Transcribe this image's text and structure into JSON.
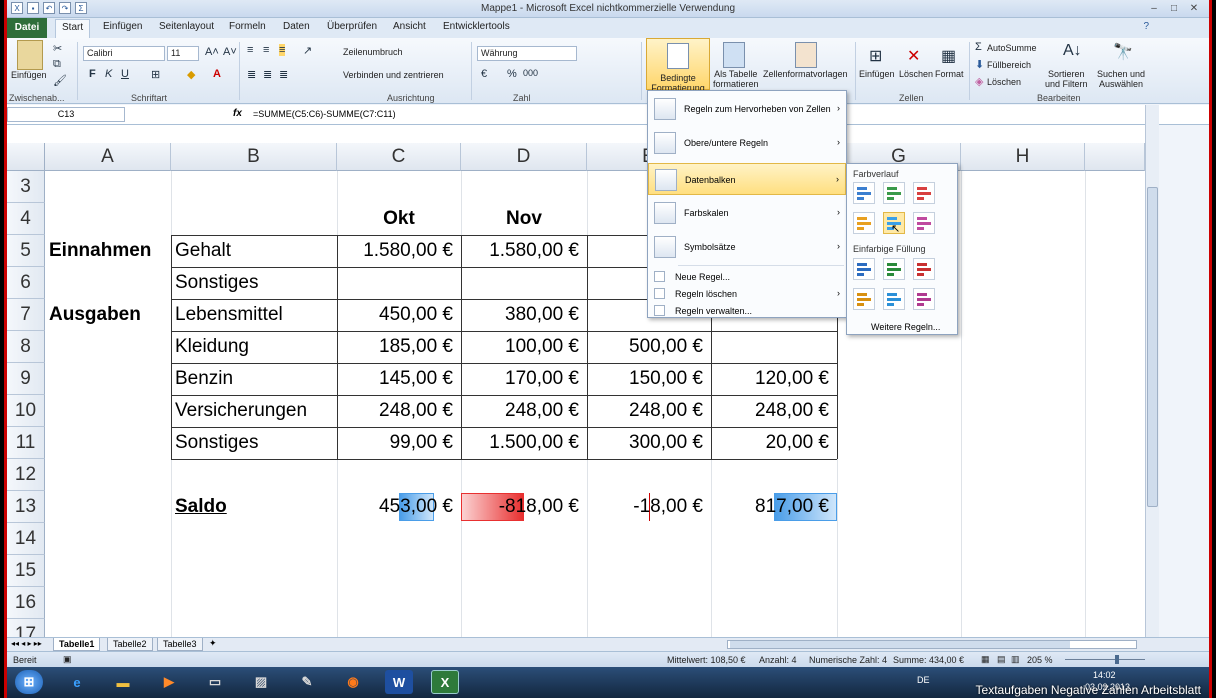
{
  "window": {
    "title": "Mappe1 - Microsoft Excel nichtkommerzielle Verwendung"
  },
  "tabs": [
    "Datei",
    "Start",
    "Einfügen",
    "Seitenlayout",
    "Formeln",
    "Daten",
    "Überprüfen",
    "Ansicht",
    "Entwicklertools"
  ],
  "ribbon": {
    "paste": "Einfügen",
    "font_name": "Calibri",
    "font_size": "11",
    "wrap": "Zeilenumbruch",
    "merge": "Verbinden und zentrieren",
    "number_format": "Währung",
    "cond_format_line1": "Bedingte",
    "cond_format_line2": "Formatierung",
    "as_table_line1": "Als Tabelle",
    "as_table_line2": "formatieren",
    "cell_styles": "Zellenformatvorlagen",
    "insert": "Einfügen",
    "delete": "Löschen",
    "format": "Format",
    "autosum": "AutoSumme",
    "fill": "Füllbereich",
    "clear": "Löschen",
    "sort_line1": "Sortieren",
    "sort_line2": "und Filtern",
    "find_line1": "Suchen und",
    "find_line2": "Auswählen",
    "groups": {
      "clipboard": "Zwischenab...",
      "font": "Schriftart",
      "alignment": "Ausrichtung",
      "number": "Zahl",
      "cells": "Zellen",
      "editing": "Bearbeiten"
    }
  },
  "formula_bar": {
    "name_box": "C13",
    "fx": "fx",
    "formula": "=SUMME(C5:C6)-SUMME(C7:C11)"
  },
  "columns": [
    "A",
    "B",
    "C",
    "D",
    "E",
    "F",
    "G",
    "H"
  ],
  "rows": [
    "3",
    "4",
    "5",
    "6",
    "7",
    "8",
    "9",
    "10",
    "11",
    "12",
    "13",
    "14",
    "15",
    "16",
    "17"
  ],
  "sheet": {
    "header_okt": "Okt",
    "header_nov": "Nov",
    "einnahmen": "Einnahmen",
    "ausgaben": "Ausgaben",
    "saldo": "Saldo",
    "items": [
      {
        "label": "Gehalt",
        "c": "1.580,00 €",
        "d": "1.580,00 €",
        "e": "",
        "f": ""
      },
      {
        "label": "Sonstiges",
        "c": "",
        "d": "",
        "e": "",
        "f": ""
      },
      {
        "label": "Lebensmittel",
        "c": "450,00 €",
        "d": "380,00 €",
        "e": "",
        "f": ""
      },
      {
        "label": "Kleidung",
        "c": "185,00 €",
        "d": "100,00 €",
        "e": "500,00 €",
        "f": ""
      },
      {
        "label": "Benzin",
        "c": "145,00 €",
        "d": "170,00 €",
        "e": "150,00 €",
        "f": "120,00 €"
      },
      {
        "label": "Versicherungen",
        "c": "248,00 €",
        "d": "248,00 €",
        "e": "248,00 €",
        "f": "248,00 €"
      },
      {
        "label": "Sonstiges",
        "c": "99,00 €",
        "d": "1.500,00 €",
        "e": "300,00 €",
        "f": "20,00 €"
      }
    ],
    "saldo_values": {
      "c": "453,00 €",
      "d": "-818,00 €",
      "e": "-18,00 €",
      "f": "817,00 €"
    },
    "saldo_bars": {
      "c": 0.28,
      "d": 0.5,
      "e": 0.01,
      "f": 0.5
    }
  },
  "menu": {
    "items": [
      "Regeln zum Hervorheben von Zellen",
      "Obere/untere Regeln",
      "Datenbalken",
      "Farbskalen",
      "Symbolsätze"
    ],
    "small_items": [
      "Neue Regel...",
      "Regeln löschen",
      "Regeln verwalten..."
    ],
    "arrow": "›"
  },
  "submenu": {
    "gradient_header": "Farbverlauf",
    "solid_header": "Einfarbige Füllung",
    "more": "Weitere Regeln..."
  },
  "sheet_tabs": [
    "Tabelle1",
    "Tabelle2",
    "Tabelle3"
  ],
  "status": {
    "ready": "Bereit",
    "avg": "Mittelwert: 108,50 €",
    "count": "Anzahl: 4",
    "numcount": "Numerische Zahl: 4",
    "sum": "Summe: 434,00 €",
    "zoom": "205 %"
  },
  "taskbar": {
    "lang": "DE",
    "time": "14:02",
    "date": "03.02.2013"
  },
  "overlay": "Textaufgaben Negative Zahlen Arbeitsblatt",
  "colors": {
    "excel_green": "#2e6e3a",
    "bar_blue": "#4a9de8",
    "bar_red": "#e83030",
    "highlight": "#ffdf80"
  }
}
